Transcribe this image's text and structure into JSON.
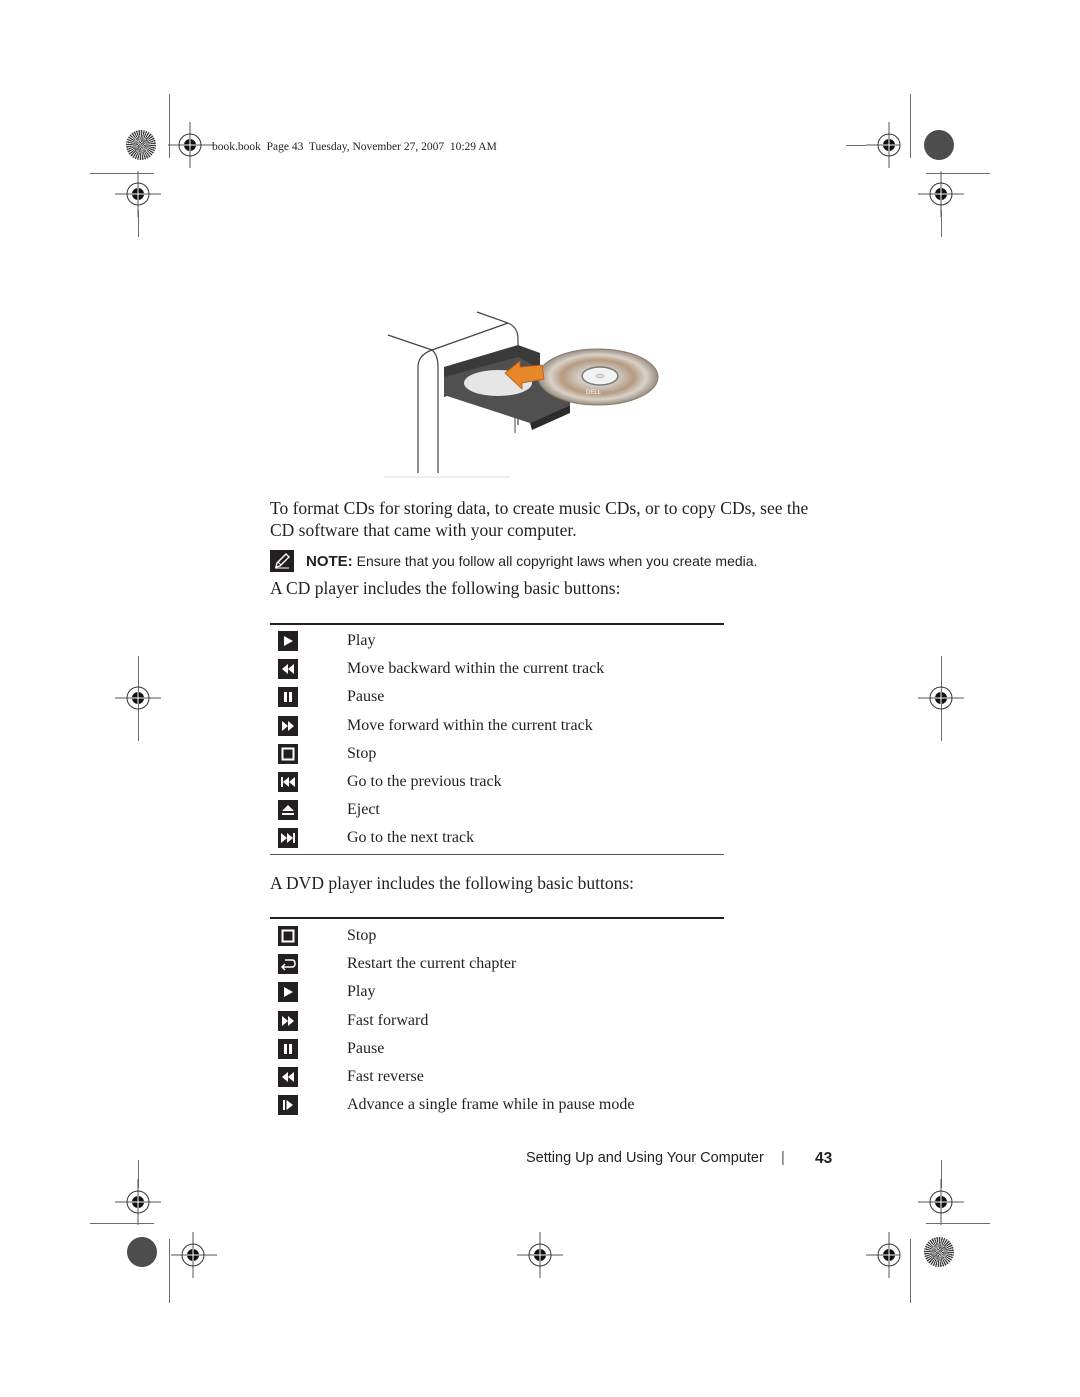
{
  "header": {
    "slug": "book.book  Page 43  Tuesday, November 27, 2007  10:29 AM"
  },
  "figure": {
    "description": "CD being inserted into an open optical drive tray of a desktop computer",
    "disc_label": "DELL",
    "arrow_color": "#e8862a"
  },
  "body": {
    "intro_line1": "To format CDs for storing data, to create music CDs, or to copy CDs, see the",
    "intro_line2": "CD software that came with your computer.",
    "note": {
      "icon": "pencil-note-icon",
      "label": "NOTE:",
      "text": "Ensure that you follow all copyright laws when you create media."
    },
    "cd_intro": "A CD player includes the following basic buttons:",
    "cd_buttons": [
      {
        "icon": "play-icon",
        "label": "Play"
      },
      {
        "icon": "rewind-icon",
        "label": "Move backward within the current track"
      },
      {
        "icon": "pause-icon",
        "label": "Pause"
      },
      {
        "icon": "fast-forward-icon",
        "label": "Move forward within the current track"
      },
      {
        "icon": "stop-icon",
        "label": "Stop"
      },
      {
        "icon": "previous-track-icon",
        "label": "Go to the previous track"
      },
      {
        "icon": "eject-icon",
        "label": "Eject"
      },
      {
        "icon": "next-track-icon",
        "label": "Go to the next track"
      }
    ],
    "dvd_intro": "A DVD player includes the following basic buttons:",
    "dvd_buttons": [
      {
        "icon": "stop-icon",
        "label": "Stop"
      },
      {
        "icon": "restart-chapter-icon",
        "label": "Restart the current chapter"
      },
      {
        "icon": "play-icon",
        "label": "Play"
      },
      {
        "icon": "fast-forward-icon",
        "label": "Fast forward"
      },
      {
        "icon": "pause-icon",
        "label": "Pause"
      },
      {
        "icon": "rewind-icon",
        "label": "Fast reverse"
      },
      {
        "icon": "frame-advance-icon",
        "label": "Advance a single frame while in pause mode"
      }
    ]
  },
  "footer": {
    "section_title": "Setting Up and Using Your Computer",
    "separator": "|",
    "page_number": "43"
  }
}
